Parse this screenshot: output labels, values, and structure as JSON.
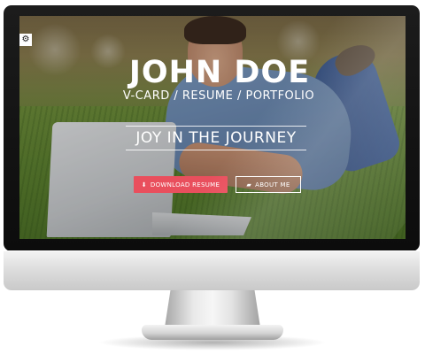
{
  "hero": {
    "name": "JOHN DOE",
    "subtitle": "V-CARD / RESUME / PORTFOLIO",
    "tagline": "JOY IN THE JOURNEY"
  },
  "buttons": {
    "download_label": "DOWNLOAD RESUME",
    "download_icon": "download-icon",
    "about_label": "ABOUT ME",
    "about_icon": "briefcase-icon"
  },
  "settings": {
    "icon": "gear-icon"
  },
  "colors": {
    "accent": "#e94f5d",
    "text": "#ffffff",
    "bezel": "#111111",
    "chin": "#dcdcdc"
  }
}
